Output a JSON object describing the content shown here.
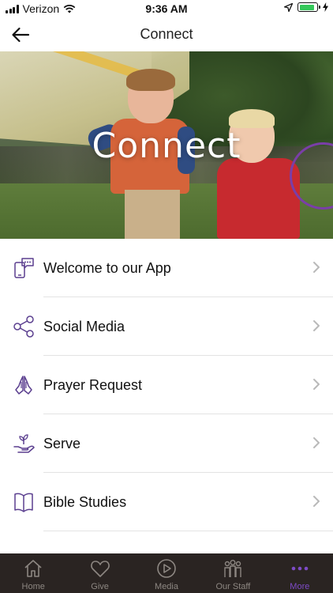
{
  "status_bar": {
    "carrier": "Verizon",
    "time": "9:36 AM",
    "battery_level": 0.9,
    "battery_color": "#34c759"
  },
  "nav": {
    "title": "Connect",
    "back_icon": "arrow-left-icon"
  },
  "hero": {
    "title": "Connect"
  },
  "menu": {
    "items": [
      {
        "label": "Welcome to our App",
        "icon": "phone-chat-icon"
      },
      {
        "label": "Social Media",
        "icon": "share-icon"
      },
      {
        "label": "Prayer Request",
        "icon": "praying-hands-icon"
      },
      {
        "label": "Serve",
        "icon": "hand-plant-icon"
      },
      {
        "label": "Bible Studies",
        "icon": "open-book-icon"
      }
    ]
  },
  "tab_bar": {
    "tabs": [
      {
        "label": "Home",
        "icon": "home-icon"
      },
      {
        "label": "Give",
        "icon": "heart-icon"
      },
      {
        "label": "Media",
        "icon": "play-icon"
      },
      {
        "label": "Our Staff",
        "icon": "people-icon"
      },
      {
        "label": "More",
        "icon": "more-dots-icon",
        "active": true
      }
    ]
  },
  "colors": {
    "accent": "#7d4bc6",
    "tab_bar_bg": "#2a2422",
    "icon_purple": "#5b3f8f"
  }
}
